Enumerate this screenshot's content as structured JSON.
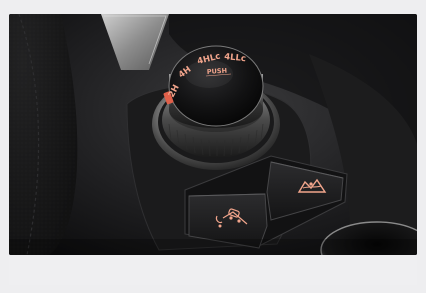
{
  "dial": {
    "modes": [
      "2H",
      "4H",
      "4HLc",
      "4LLc"
    ],
    "push_label": "PUSH"
  },
  "colors": {
    "indicator": "#f2a58c",
    "background": "#eeeef0"
  },
  "icons": [
    "hill-descent-control-icon",
    "terrain-mode-icon"
  ]
}
